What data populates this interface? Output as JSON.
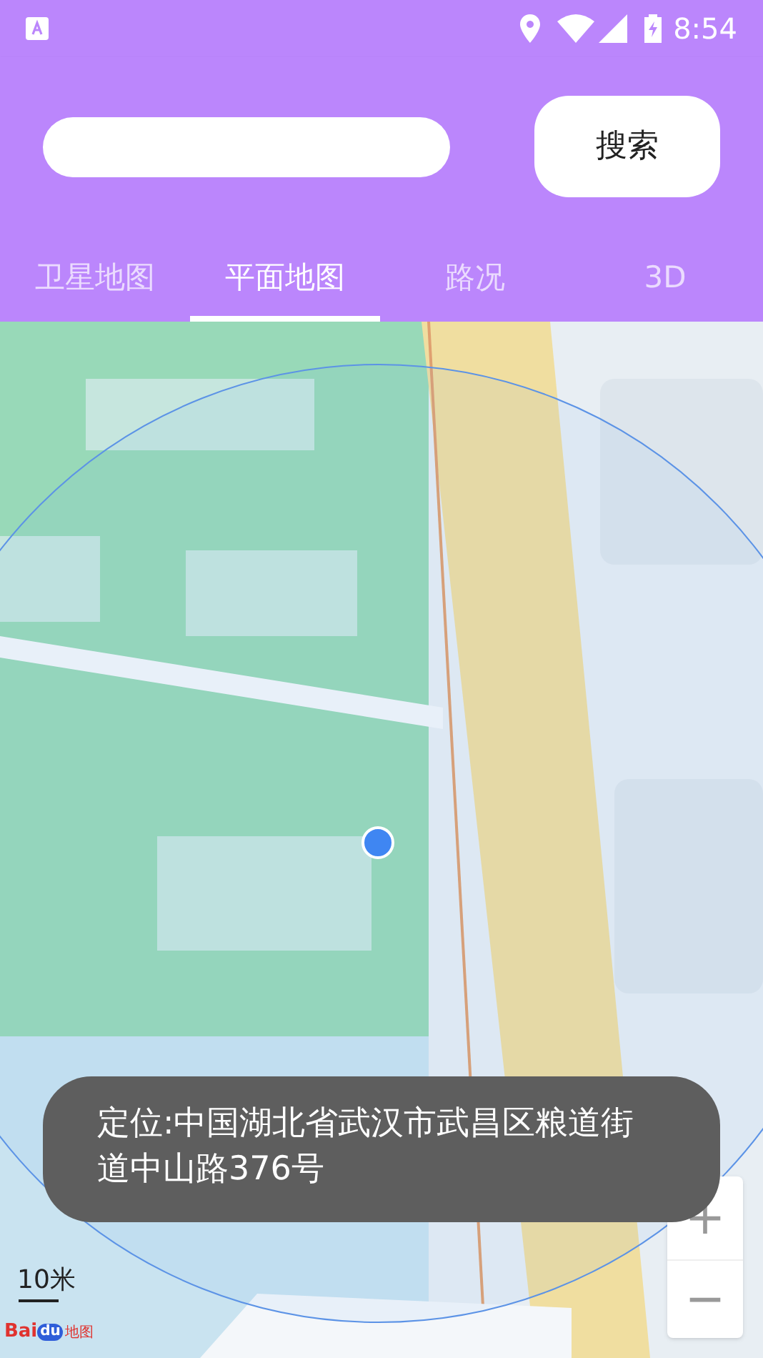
{
  "status_bar": {
    "time": "8:54"
  },
  "search": {
    "button": "搜索"
  },
  "tabs": [
    {
      "label": "卫星地图",
      "selected": false
    },
    {
      "label": "平面地图",
      "selected": true
    },
    {
      "label": "路况",
      "selected": false
    },
    {
      "label": "3D",
      "selected": false
    }
  ],
  "map": {
    "scale": "10米",
    "logo": {
      "brand": "Bai",
      "badge": "du",
      "suffix": "地图"
    },
    "zoom_in": "+",
    "zoom_out": "−"
  },
  "toast": "定位:中国湖北省武汉市武昌区粮道街道中山路376号"
}
